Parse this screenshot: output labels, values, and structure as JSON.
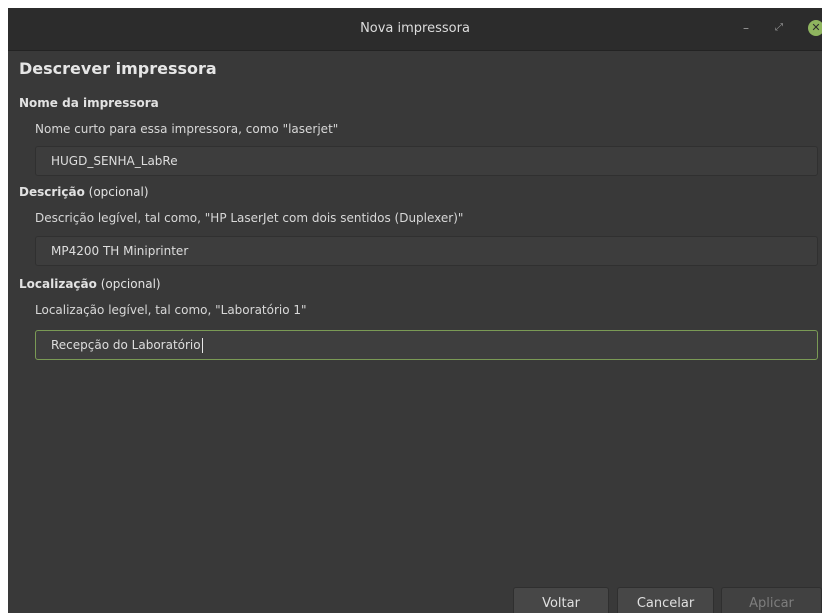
{
  "window": {
    "title": "Nova impressora",
    "controls": {
      "minimize": "–",
      "maximize": "⤢",
      "close": "✕"
    }
  },
  "page": {
    "heading": "Descrever impressora"
  },
  "printer_name": {
    "label": "Nome da impressora",
    "hint": "Nome curto para essa impressora, como \"laserjet\"",
    "value": "HUGD_SENHA_LabRe"
  },
  "description": {
    "label": "Descrição",
    "optional": " (opcional)",
    "hint": "Descrição legível, tal como, \"HP LaserJet com dois sentidos (Duplexer)\"",
    "value": "MP4200 TH Miniprinter"
  },
  "location": {
    "label": "Localização",
    "optional": " (opcional)",
    "hint": "Localização legível, tal como, \"Laboratório 1\"",
    "value": "Recepção do Laboratório"
  },
  "buttons": {
    "back": "Voltar",
    "cancel": "Cancelar",
    "apply": "Aplicar"
  }
}
